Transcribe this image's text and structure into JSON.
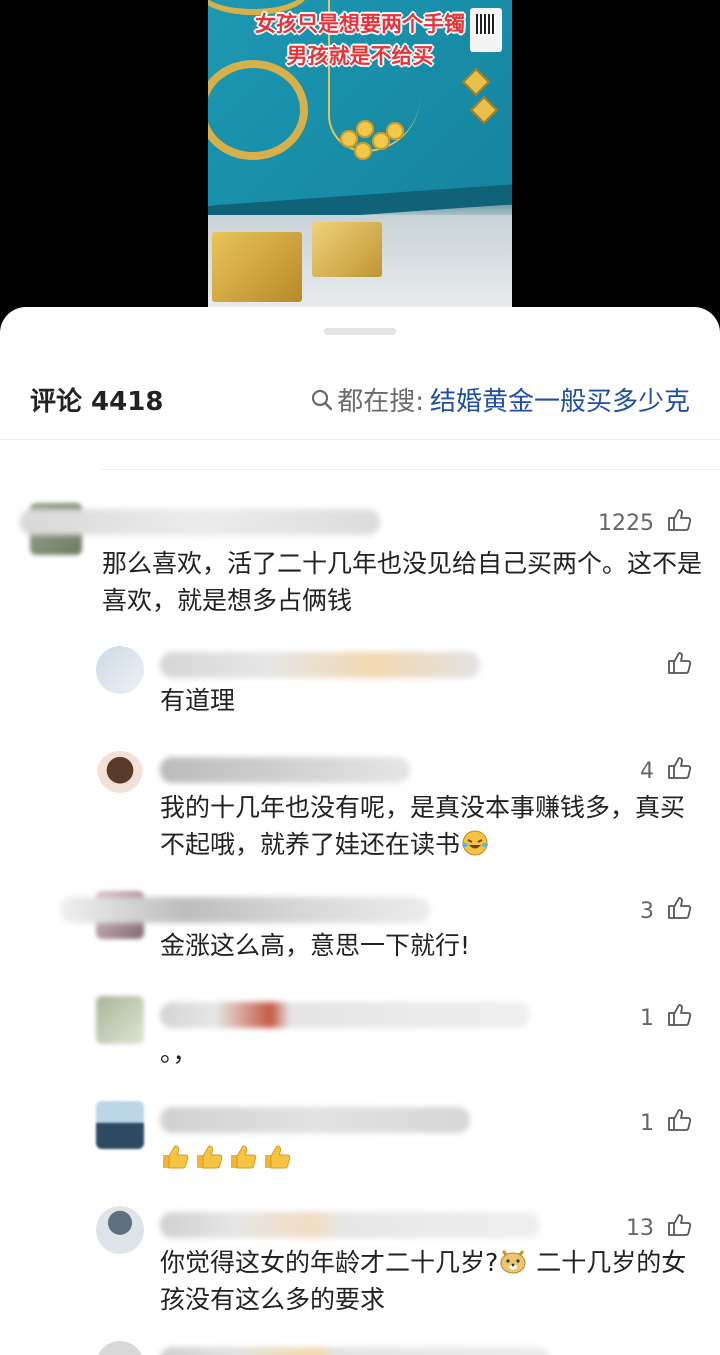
{
  "video": {
    "caption_line1": "女孩只是想要两个手镯",
    "caption_line2": "男孩就是不给买"
  },
  "comments_panel": {
    "title": "评论 4418",
    "search_prefix": "都在搜:",
    "search_query": "结婚黄金一般买多少克"
  },
  "comments": [
    {
      "likes": "1225",
      "text": "那么喜欢，活了二十几年也没见给自己买两个。这不是喜欢，就是想多占俩钱"
    },
    {
      "likes": "",
      "text": "有道理"
    },
    {
      "likes": "4",
      "text": "我的十几年也没有呢，是真没本事赚钱多，真买不起哦，就养了娃还在读书"
    },
    {
      "likes": "3",
      "text": "金涨这么高，意思一下就行!"
    },
    {
      "likes": "1",
      "text": "。，"
    },
    {
      "likes": "1",
      "text": ""
    },
    {
      "likes": "13",
      "text_a": "你觉得这女的年龄才二十几岁?",
      "text_b": " 二十几岁的女孩没有这么多的要求"
    }
  ],
  "icons": {
    "like": "thumbs-up-icon",
    "search": "search-icon",
    "laugh": "laughing-crying-emoji",
    "thumbs": "thumbs-up-emoji",
    "doge": "doge-emoji"
  },
  "colors": {
    "search_query": "#1f4f9e",
    "caption": "#e8323a"
  }
}
